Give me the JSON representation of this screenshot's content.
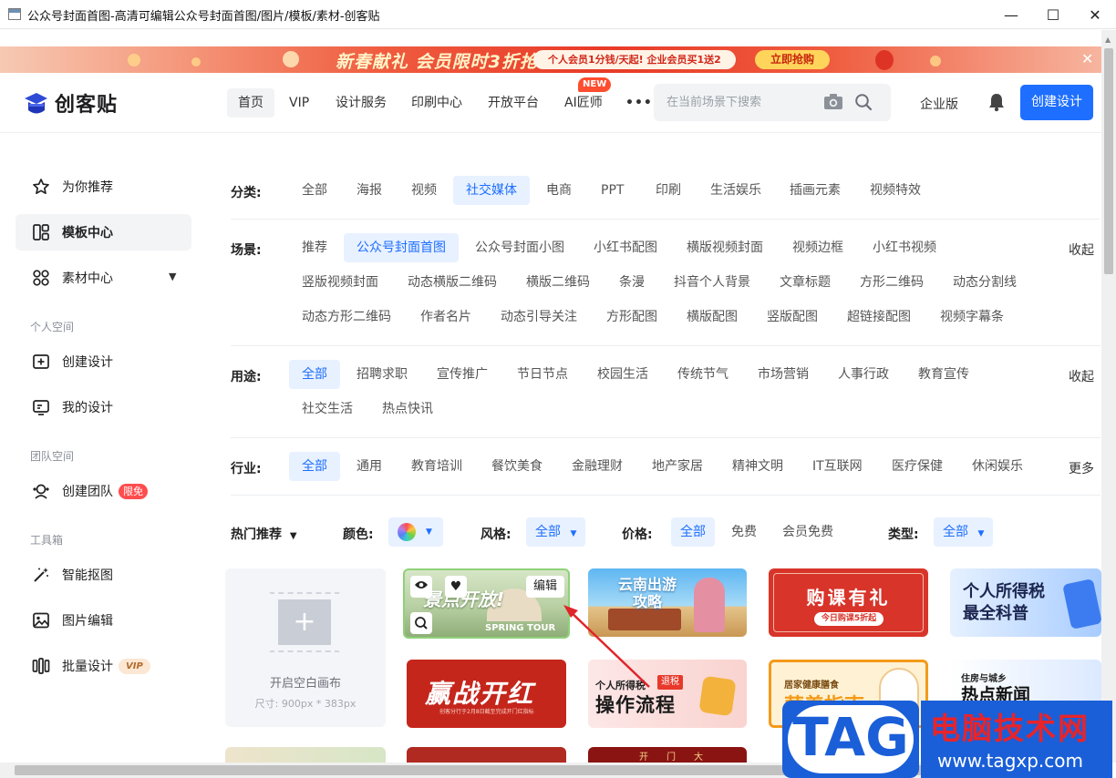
{
  "window": {
    "title": "公众号封面首图-高清可编辑公众号封面首图/图片/模板/素材-创客贴"
  },
  "banner": {
    "headline": "新春献礼 会员限时3折抢",
    "promo": "个人会员1分钱/天起! 企业会员买1送2",
    "cta": "立即抢购"
  },
  "header": {
    "logo": "创客贴",
    "nav": [
      "首页",
      "VIP",
      "设计服务",
      "印刷中心",
      "开放平台",
      "AI匠师"
    ],
    "new_badge": "NEW",
    "more": "•••",
    "search_placeholder": "在当前场景下搜索",
    "enterprise": "企业版",
    "create": "创建设计"
  },
  "sidebar": {
    "items": [
      {
        "label": "为你推荐",
        "icon": "star-icon"
      },
      {
        "label": "模板中心",
        "icon": "template-icon"
      },
      {
        "label": "素材中心",
        "icon": "material-icon"
      }
    ],
    "personal_section": "个人空间",
    "personal": [
      {
        "label": "创建设计",
        "icon": "add-design-icon"
      },
      {
        "label": "我的设计",
        "icon": "my-design-icon"
      }
    ],
    "team_section": "团队空间",
    "team_create": "创建团队",
    "team_tag": "限免",
    "tools_section": "工具箱",
    "tools": [
      {
        "label": "智能抠图",
        "icon": "magic-wand-icon"
      },
      {
        "label": "图片编辑",
        "icon": "image-edit-icon"
      },
      {
        "label": "批量设计",
        "icon": "batch-icon"
      }
    ],
    "vip_tag": "VIP"
  },
  "filters": {
    "category_label": "分类:",
    "categories": [
      "全部",
      "海报",
      "视频",
      "社交媒体",
      "电商",
      "PPT",
      "印刷",
      "生活娱乐",
      "插画元素",
      "视频特效"
    ],
    "scene_label": "场景:",
    "scenes_row1": [
      "推荐",
      "公众号封面首图",
      "公众号封面小图",
      "小红书配图",
      "横版视频封面",
      "视频边框",
      "小红书视频"
    ],
    "scenes_row2": [
      "竖版视频封面",
      "动态横版二维码",
      "横版二维码",
      "条漫",
      "抖音个人背景",
      "文章标题",
      "方形二维码",
      "动态分割线"
    ],
    "scenes_row3": [
      "动态方形二维码",
      "作者名片",
      "动态引导关注",
      "方形配图",
      "横版配图",
      "竖版配图",
      "超链接配图",
      "视频字幕条"
    ],
    "usage_label": "用途:",
    "usages_row1": [
      "全部",
      "招聘求职",
      "宣传推广",
      "节日节点",
      "校园生活",
      "传统节气",
      "市场营销",
      "人事行政",
      "教育宣传"
    ],
    "usages_row2": [
      "社交生活",
      "热点快讯"
    ],
    "industry_label": "行业:",
    "industries": [
      "全部",
      "通用",
      "教育培训",
      "餐饮美食",
      "金融理财",
      "地产家居",
      "精神文明",
      "IT互联网",
      "医疗保健",
      "休闲娱乐"
    ],
    "collapse": "收起",
    "more": "更多"
  },
  "sortbar": {
    "hot": "热门推荐",
    "color_label": "颜色:",
    "style_label": "风格:",
    "style_value": "全部",
    "price_label": "价格:",
    "price_options": [
      "全部",
      "免费",
      "会员免费"
    ],
    "type_label": "类型:",
    "type_value": "全部"
  },
  "blank_canvas": {
    "title": "开启空白画布",
    "size": "尺寸: 900px * 383px"
  },
  "cards": [
    {
      "text": "景点开放!",
      "sub": "SPRING TOUR",
      "edit": "编辑"
    },
    {
      "text": "云南出游攻略"
    },
    {
      "text": "购课有礼",
      "sub": "今日购课5折起"
    },
    {
      "text": "个人所得税最全科普"
    },
    {
      "text": "赢战开红",
      "sub": "创客分行于2月8日截至完成开门红指标"
    },
    {
      "text": "个人所得税",
      "sub": "操作流程",
      "badge": "退税"
    },
    {
      "text": "居家健康膳食",
      "sub": "营养指南"
    },
    {
      "text": "住房与城乡",
      "sub": "热点新闻"
    }
  ],
  "bottom_partial": [
    "开",
    "门",
    "大"
  ],
  "watermark": {
    "tag": "TAG",
    "title": "电脑技术网",
    "url": "www.tagxp.com"
  },
  "colors": {
    "accent": "#1e6fff",
    "accent_bg": "#e8f1ff",
    "red": "#e8392a"
  }
}
